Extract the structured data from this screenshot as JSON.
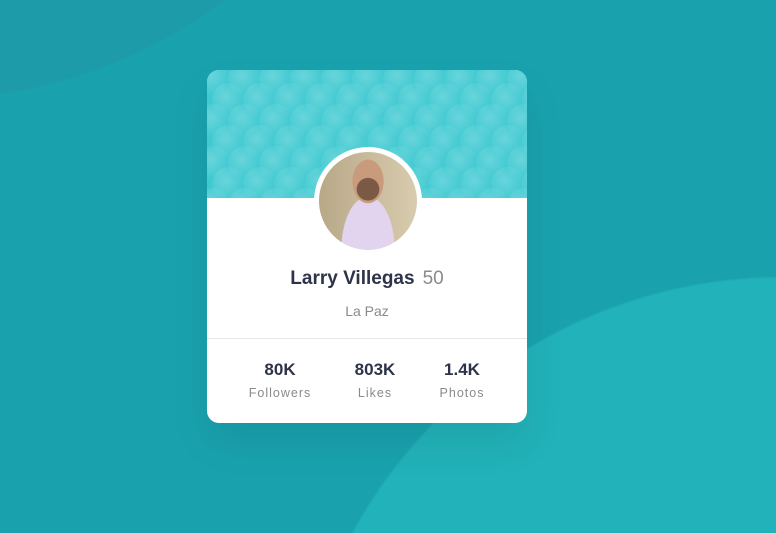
{
  "profile": {
    "name": "Larry Villegas",
    "age": "50",
    "location": "La Paz"
  },
  "stats": [
    {
      "value": "80K",
      "label": "Followers"
    },
    {
      "value": "803K",
      "label": "Likes"
    },
    {
      "value": "1.4K",
      "label": "Photos"
    }
  ],
  "colors": {
    "background": "#19a2ae",
    "header": "#3fc9d1",
    "text": "#2e3349",
    "muted": "#8a8a8a"
  }
}
